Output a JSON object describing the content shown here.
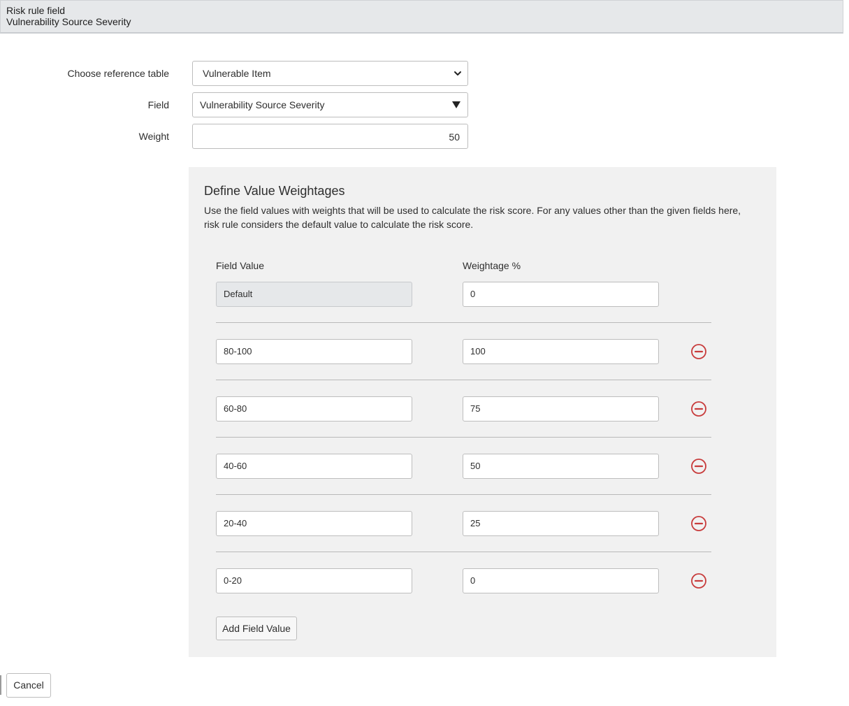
{
  "header": {
    "title": "Risk rule field",
    "subtitle": "Vulnerability Source Severity"
  },
  "form": {
    "reference_table": {
      "label": "Choose reference table",
      "value": "Vulnerable Item"
    },
    "field": {
      "label": "Field",
      "value": "Vulnerability Source Severity"
    },
    "weight": {
      "label": "Weight",
      "value": "50"
    }
  },
  "weightages": {
    "title": "Define Value Weightages",
    "description": "Use the field values with weights that will be used to calculate the risk score. For any values other than the given fields here, risk rule considers the default value to calculate the risk score.",
    "col_field_value": "Field Value",
    "col_weightage": "Weightage %",
    "default_row": {
      "field_value": "Default",
      "weightage": "0"
    },
    "rows": [
      {
        "field_value": "80-100",
        "weightage": "100"
      },
      {
        "field_value": "60-80",
        "weightage": "75"
      },
      {
        "field_value": "40-60",
        "weightage": "50"
      },
      {
        "field_value": "20-40",
        "weightage": "25"
      },
      {
        "field_value": "0-20",
        "weightage": "0"
      }
    ],
    "add_button": "Add Field Value"
  },
  "footer": {
    "cancel_button": "Cancel"
  },
  "icons": {
    "remove": "minus-circle-icon",
    "select_chevron": "chevron-down-icon",
    "reference_caret": "triangle-down-icon"
  },
  "colors": {
    "remove_icon": "#c83c3c",
    "panel_bg": "#f1f1f1",
    "header_bg": "#e6e8ea"
  }
}
